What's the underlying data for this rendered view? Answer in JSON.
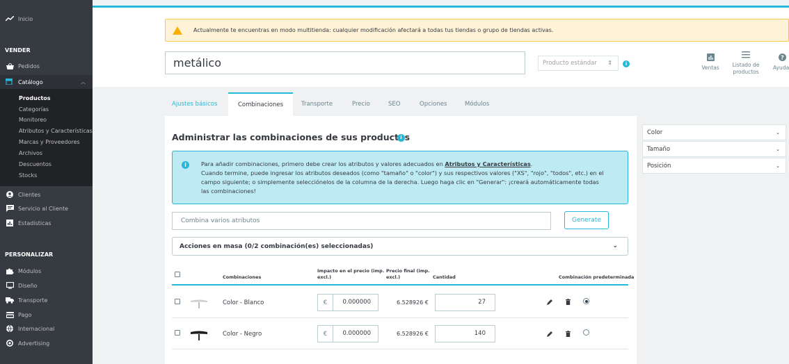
{
  "sidebar": {
    "inicio": "Inicio",
    "vender": "VENDER",
    "pedidos": "Pedidos",
    "catalogo": "Catálogo",
    "catalogo_sub": [
      "Productos",
      "Categorías",
      "Monitoreo",
      "Atributos y Características",
      "Marcas y Proveedores",
      "Archivos",
      "Descuentos",
      "Stocks"
    ],
    "clientes": "Clientes",
    "servicio": "Servicio al Cliente",
    "estadisticas": "Estadísticas",
    "personalizar": "PERSONALIZAR",
    "modulos": "Módulos",
    "diseno": "Diseño",
    "transporte": "Transporte",
    "pago": "Pago",
    "internacional": "Internacional",
    "advertising": "Advertising"
  },
  "warning": "Actualmente te encuentras en modo multitienda: cualquier modificación afectará a todas tus tiendas o grupo de tiendas activas.",
  "product_name": "metálico",
  "product_type": "Producto estándar",
  "toolbar": {
    "ventas": "Ventas",
    "listado_1": "Listado de",
    "listado_2": "productos",
    "ayuda": "Ayuda"
  },
  "tabs": [
    "Ajustes básicos",
    "Combinaciones",
    "Transporte",
    "Precio",
    "SEO",
    "Opciones",
    "Módulos"
  ],
  "section_title": "Administrar las combinaciones de sus productos",
  "alert": {
    "line1_pre": "Para añadir combinaciones, primero debe crear los atributos y valores adecuados en ",
    "line1_link": "Atributos y Características",
    "line1_post": ".",
    "line2": "Cuando termine, puede ingresar los atributos deseados (como \"tamaño\" o \"color\") y sus respectivos valores (\"XS\", \"rojo\", \"todos\", etc.) en el",
    "line3": "campo siguiente; o simplemente selecciónelos de la columna de la derecha. Luego haga clic en \"Generar\": ¡creará automáticamente todas",
    "line4": "las combinaciones!"
  },
  "combine_placeholder": "Combina varios atributos",
  "generate_label": "Generate",
  "bulk_label": "Acciones en masa (0/2 combinación(es) seleccionadas)",
  "table_headers": {
    "combinaciones": "Combinaciones",
    "impacto_1": "Impacto en el precio (imp.",
    "impacto_2": "excl.)",
    "final_1": "Precio final (imp.",
    "final_2": "excl.)",
    "cantidad": "Cantidad",
    "predeterminada": "Combinación predeterminada"
  },
  "rows": [
    {
      "label": "Color - Blanco",
      "currency": "€",
      "impact": "0.000000",
      "final": "6.528926 €",
      "qty": "27",
      "default": true
    },
    {
      "label": "Color - Negro",
      "currency": "€",
      "impact": "0.000000",
      "final": "6.528926 €",
      "qty": "140",
      "default": false
    }
  ],
  "attribute_filters": [
    "Color",
    "Tamaño",
    "Posición"
  ]
}
